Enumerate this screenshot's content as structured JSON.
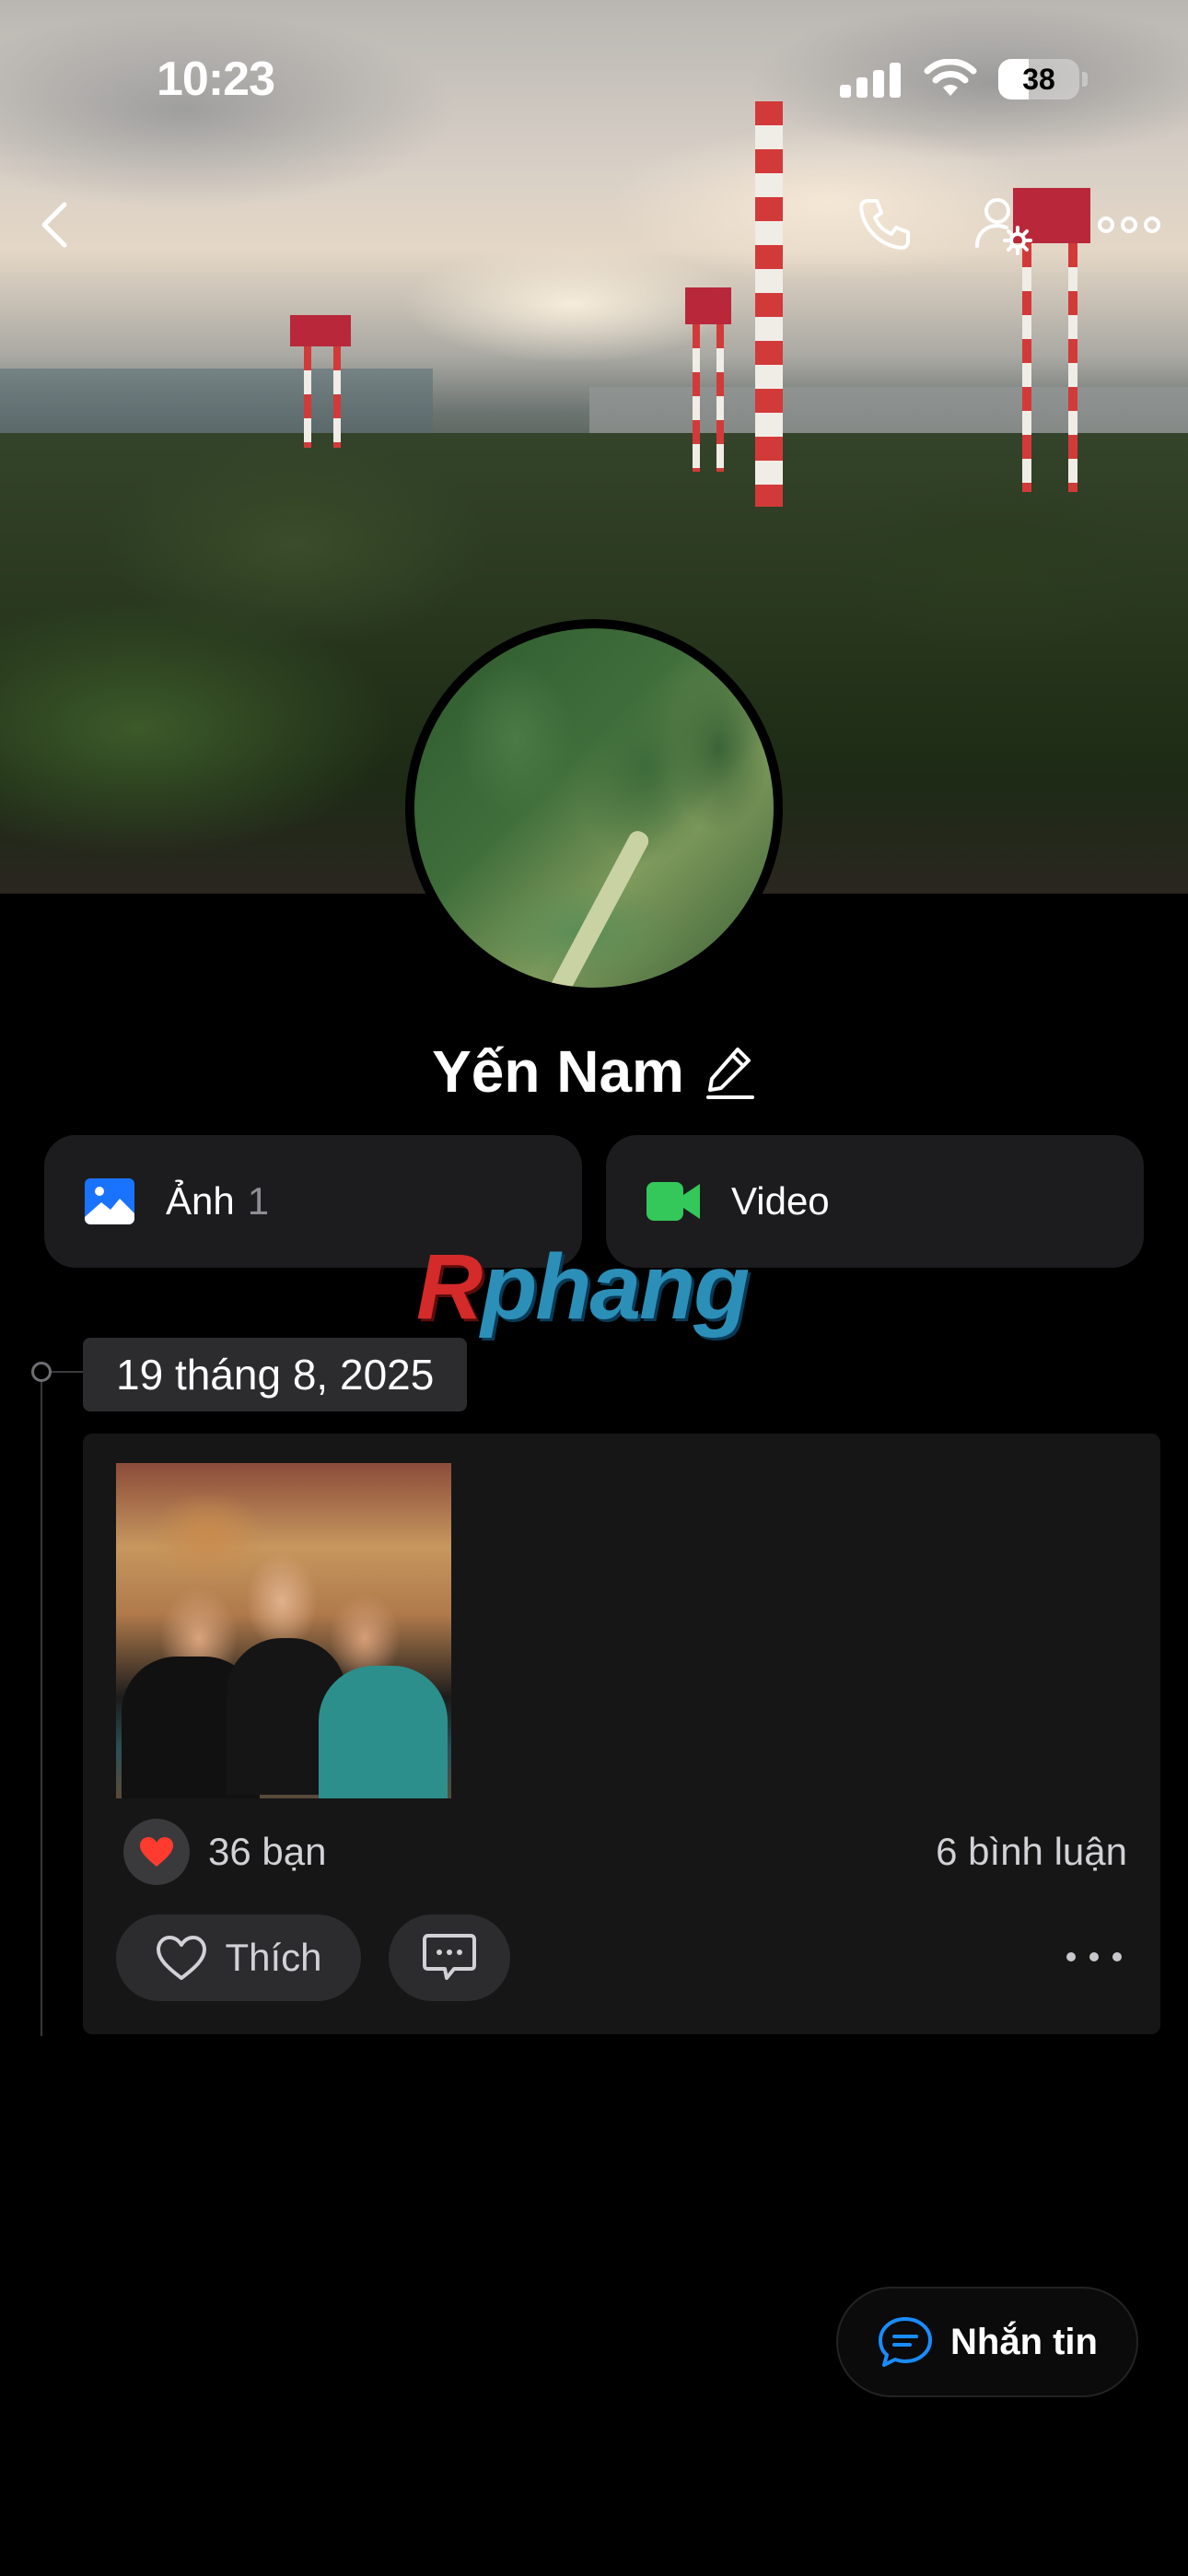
{
  "status_bar": {
    "time": "10:23",
    "battery": "38",
    "battery_level": 0.38
  },
  "profile": {
    "name": "Yến Nam"
  },
  "media_tabs": [
    {
      "label": "Ảnh",
      "count": "1",
      "icon": "photo-icon"
    },
    {
      "label": "Video",
      "count": "",
      "icon": "video-icon"
    }
  ],
  "watermark": {
    "first": "R",
    "rest": "phang"
  },
  "timeline": {
    "date": "19 tháng 8, 2025",
    "post": {
      "reactions": "36 bạn",
      "comments": "6 bình luận",
      "like_label": "Thích"
    }
  },
  "floating": {
    "message_label": "Nhắn tin"
  },
  "colors": {
    "accent_blue": "#1a73ff",
    "video_green": "#34c759",
    "heart_red": "#ff3b30",
    "card_bg": "#161616",
    "tile_bg": "#1c1c1e"
  }
}
